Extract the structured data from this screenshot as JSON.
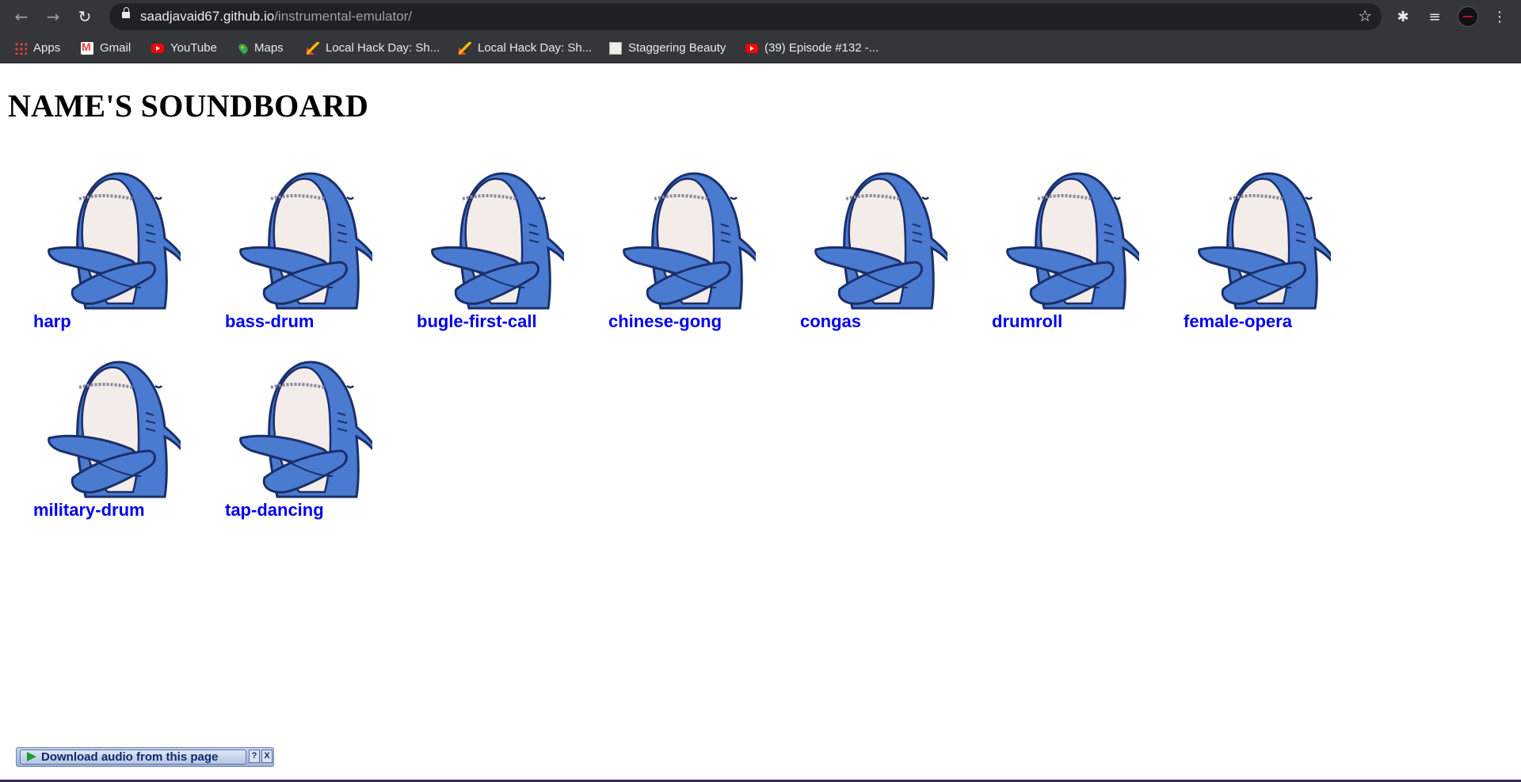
{
  "browser": {
    "url_host": "saadjavaid67.github.io",
    "url_path": "/instrumental-emulator/",
    "bookmarks": [
      {
        "label": "Apps",
        "icon": "apps-grid-icon"
      },
      {
        "label": "Gmail",
        "icon": "gmail-icon"
      },
      {
        "label": "YouTube",
        "icon": "youtube-icon"
      },
      {
        "label": "Maps",
        "icon": "maps-icon"
      },
      {
        "label": "Local Hack Day: Sh...",
        "icon": "local-hack-day-icon"
      },
      {
        "label": "Local Hack Day: Sh...",
        "icon": "local-hack-day-icon"
      },
      {
        "label": "Staggering Beauty",
        "icon": "staggering-beauty-icon"
      },
      {
        "label": "(39) Episode #132 -...",
        "icon": "youtube-icon"
      }
    ]
  },
  "page": {
    "title": "NAME'S SOUNDBOARD",
    "sounds": [
      {
        "label": "harp"
      },
      {
        "label": "bass-drum"
      },
      {
        "label": "bugle-first-call"
      },
      {
        "label": "chinese-gong"
      },
      {
        "label": "congas"
      },
      {
        "label": "drumroll"
      },
      {
        "label": "female-opera"
      },
      {
        "label": "military-drum"
      },
      {
        "label": "tap-dancing"
      }
    ]
  },
  "download_bar": {
    "label": "Download audio from this page",
    "help": "?",
    "close": "X"
  }
}
